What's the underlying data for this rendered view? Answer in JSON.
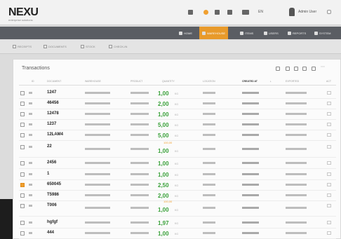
{
  "app": {
    "logo_text": "NEXU",
    "logo_sub": "enterprise solutions"
  },
  "header": {
    "lang": "EN",
    "user_name": "Admin User"
  },
  "nav": {
    "items": [
      {
        "label": "HOME",
        "active": false
      },
      {
        "label": "WAREHOUSE",
        "active": true
      },
      {
        "label": "ITEMS",
        "active": false
      },
      {
        "label": "USERS",
        "active": false
      },
      {
        "label": "REPORTS",
        "active": false
      },
      {
        "label": "SYSTEM",
        "active": false
      }
    ]
  },
  "subnav": {
    "items": [
      {
        "label": "RECEIPTS"
      },
      {
        "label": "DOCUMENTS"
      },
      {
        "label": "STOCK"
      },
      {
        "label": "CHECK-IN"
      }
    ]
  },
  "panel": {
    "title": "Transactions"
  },
  "table": {
    "columns": [
      "ID",
      "DOCUMENT",
      "WAREHOUSE",
      "PRODUCT",
      "QUANTITY",
      "LOCATION",
      "CREATED AT",
      "EXPORTED",
      "ACT"
    ],
    "sorted_column": "CREATED AT",
    "sort_indicator": "↓",
    "rows": [
      {
        "doc": "1247",
        "qty": "1,00",
        "unit": "KG",
        "warn": "",
        "checked": false
      },
      {
        "doc": "46456",
        "qty": "2,00",
        "unit": "KG",
        "warn": "",
        "checked": false
      },
      {
        "doc": "12478",
        "qty": "1,00",
        "unit": "KG",
        "warn": "",
        "checked": false
      },
      {
        "doc": "1237",
        "qty": "5,00",
        "unit": "KG",
        "warn": "",
        "checked": false
      },
      {
        "doc": "12LAM4",
        "qty": "5,00",
        "unit": "KG",
        "warn": "",
        "checked": false
      },
      {
        "doc": "22",
        "qty": "1,00",
        "unit": "KG",
        "warn": "100,00",
        "checked": false
      },
      {
        "doc": "2456",
        "qty": "1,00",
        "unit": "KG",
        "warn": "",
        "checked": false
      },
      {
        "doc": "1",
        "qty": "1,00",
        "unit": "KG",
        "warn": "",
        "checked": false
      },
      {
        "doc": "650045",
        "qty": "2,50",
        "unit": "KG",
        "warn": "",
        "checked": true
      },
      {
        "doc": "T5986",
        "qty": "2,00",
        "unit": "KG",
        "warn": "",
        "checked": false
      },
      {
        "doc": "T006",
        "qty": "1,00",
        "unit": "KG",
        "warn": "100,00",
        "checked": false
      },
      {
        "doc": "hgfgf",
        "qty": "1,97",
        "unit": "KG",
        "warn": "",
        "checked": false
      },
      {
        "doc": "444",
        "qty": "1,00",
        "unit": "KG",
        "warn": "",
        "checked": false
      }
    ]
  }
}
